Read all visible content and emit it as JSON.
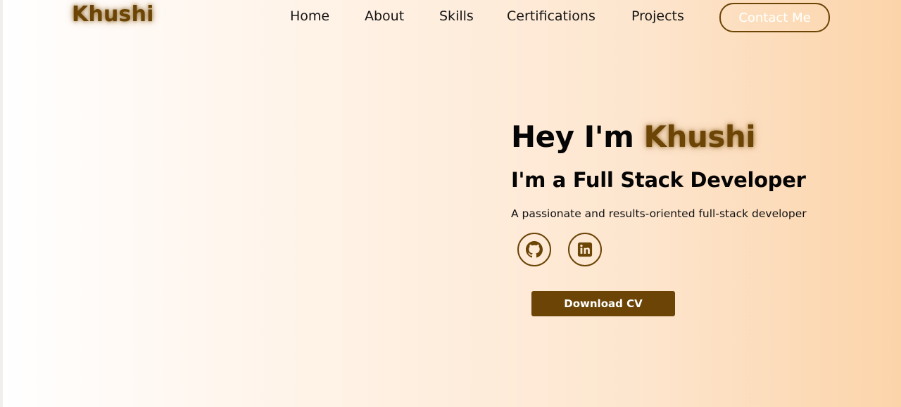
{
  "brand": {
    "logo_text": "Khushi",
    "accent_color": "#6b4406"
  },
  "nav": {
    "links": [
      {
        "label": "Home"
      },
      {
        "label": "About"
      },
      {
        "label": "Skills"
      },
      {
        "label": "Certifications"
      },
      {
        "label": "Projects"
      }
    ],
    "contact_label": "Contact Me"
  },
  "hero": {
    "greeting": "Hey I'm",
    "name": "Khushi",
    "subtitle": "I'm a Full Stack Developer",
    "description": "A passionate and results-oriented full-stack developer",
    "socials": [
      {
        "icon": "github-icon"
      },
      {
        "icon": "linkedin-icon"
      }
    ],
    "cta_label": "Download CV"
  }
}
